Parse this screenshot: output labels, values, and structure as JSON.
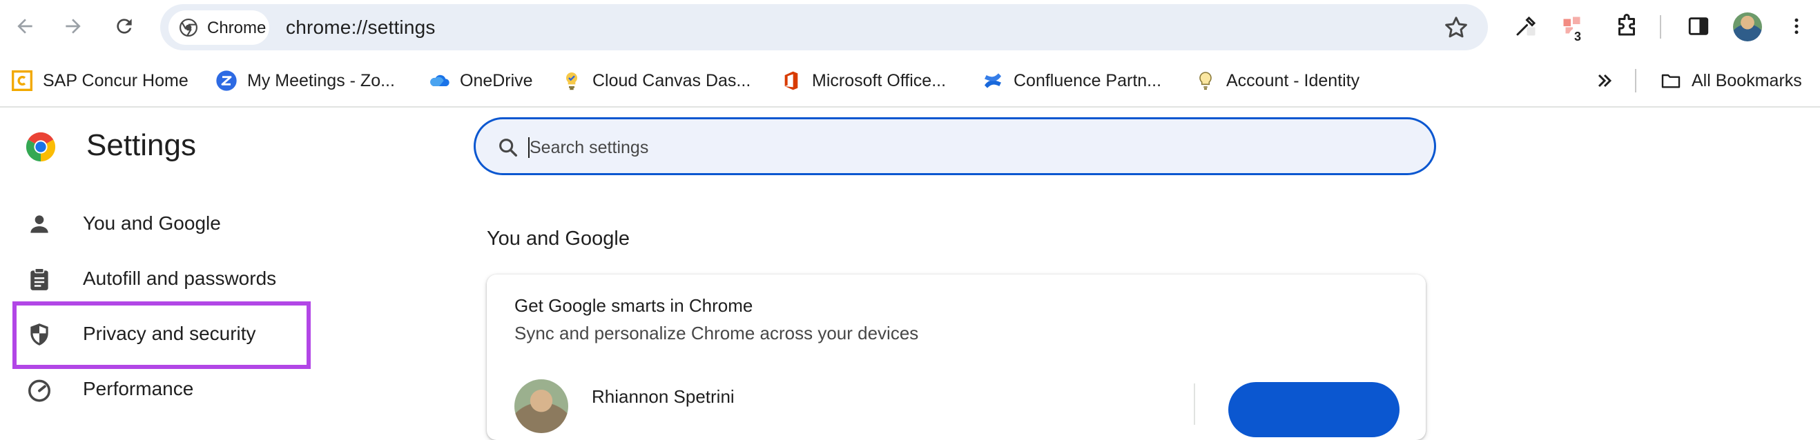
{
  "toolbar": {
    "chip_label": "Chrome",
    "url": "chrome://settings",
    "extension_badge": "3"
  },
  "bookmarks": [
    {
      "label": "SAP Concur Home",
      "icon": "sap-concur-icon"
    },
    {
      "label": "My Meetings - Zo...",
      "icon": "zoom-icon"
    },
    {
      "label": "OneDrive",
      "icon": "onedrive-icon"
    },
    {
      "label": "Cloud Canvas Das...",
      "icon": "cloud-canvas-icon"
    },
    {
      "label": "Microsoft Office...",
      "icon": "microsoft-office-icon"
    },
    {
      "label": "Confluence Partn...",
      "icon": "confluence-icon"
    },
    {
      "label": "Account - Identity",
      "icon": "lightbulb-icon"
    }
  ],
  "all_bookmarks_label": "All Bookmarks",
  "settings": {
    "title": "Settings",
    "search_placeholder": "Search settings",
    "nav": [
      {
        "label": "You and Google",
        "icon": "person-icon"
      },
      {
        "label": "Autofill and passwords",
        "icon": "clipboard-icon"
      },
      {
        "label": "Privacy and security",
        "icon": "shield-icon"
      },
      {
        "label": "Performance",
        "icon": "speedometer-icon"
      }
    ],
    "section_title": "You and Google",
    "card": {
      "title": "Get Google smarts in Chrome",
      "subtitle": "Sync and personalize Chrome across your devices",
      "account_name": "Rhiannon Spetrini"
    }
  },
  "colors": {
    "accent": "#0b57d0",
    "highlight_box": "#b246e6",
    "omnibox_bg": "#e9eef6"
  }
}
